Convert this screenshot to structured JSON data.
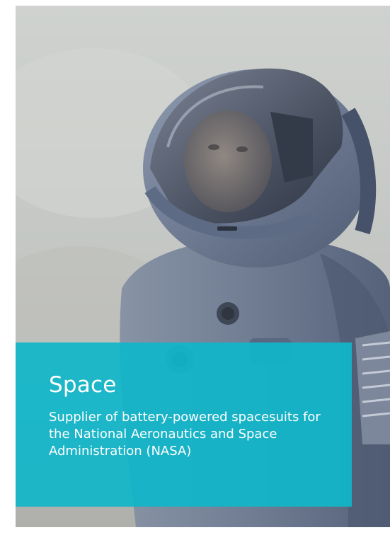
{
  "card": {
    "title": "Space",
    "description": "Supplier of battery-powered spacesuits for the National Aeronautics and Space Administration (NASA)"
  },
  "colors": {
    "overlay": "#10b6c9",
    "text": "#ffffff",
    "sky": "#c6c9c7",
    "suit": "#6d7a90"
  }
}
